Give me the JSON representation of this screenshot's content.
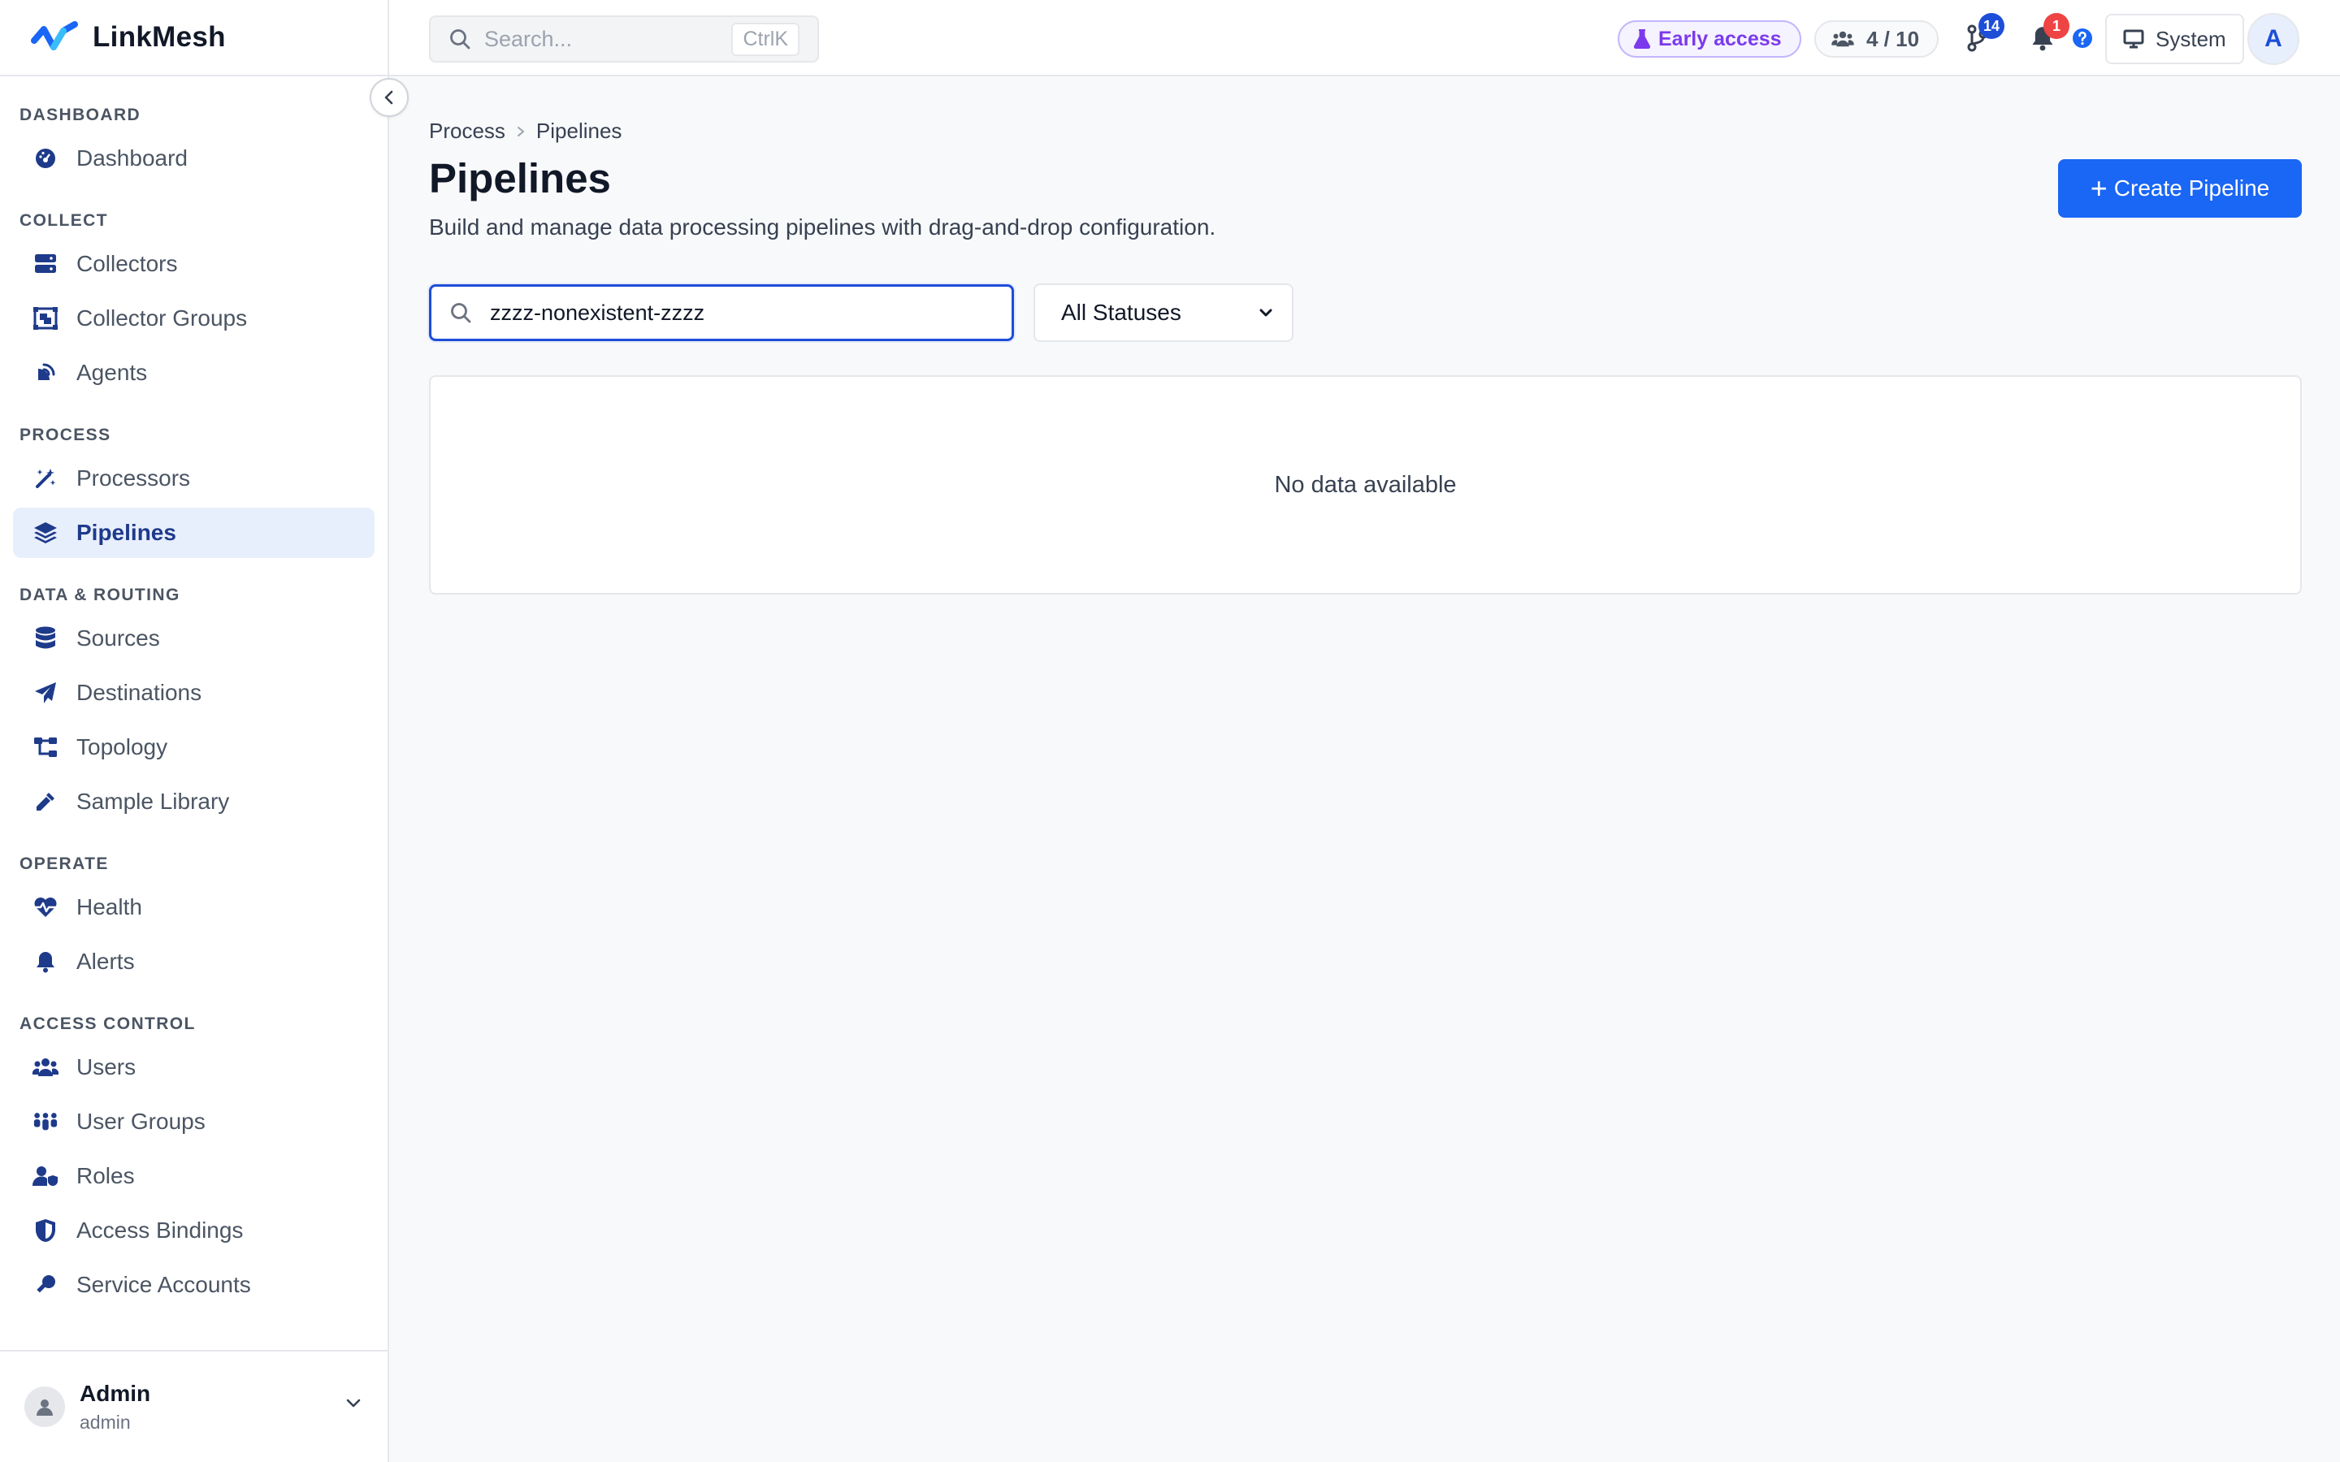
{
  "brand": {
    "name": "LinkMesh"
  },
  "topbar": {
    "search_placeholder": "Search...",
    "search_shortcut": "CtrlK",
    "early_access_label": "Early access",
    "seats_used": "4 / 10",
    "git_badge_count": "14",
    "notifications_count": "1",
    "theme_label": "System",
    "avatar_initial": "A"
  },
  "sidebar": {
    "sections": [
      {
        "title": "DASHBOARD",
        "items": [
          {
            "label": "Dashboard",
            "icon": "dashboard-icon"
          }
        ]
      },
      {
        "title": "COLLECT",
        "items": [
          {
            "label": "Collectors",
            "icon": "server-icon"
          },
          {
            "label": "Collector Groups",
            "icon": "object-group-icon"
          },
          {
            "label": "Agents",
            "icon": "satellite-dish-icon"
          }
        ]
      },
      {
        "title": "PROCESS",
        "items": [
          {
            "label": "Processors",
            "icon": "magic-wand-icon"
          },
          {
            "label": "Pipelines",
            "icon": "layers-icon",
            "active": true
          }
        ]
      },
      {
        "title": "DATA & ROUTING",
        "items": [
          {
            "label": "Sources",
            "icon": "database-icon"
          },
          {
            "label": "Destinations",
            "icon": "paper-plane-icon"
          },
          {
            "label": "Topology",
            "icon": "sitemap-icon"
          },
          {
            "label": "Sample Library",
            "icon": "eyedropper-icon"
          }
        ]
      },
      {
        "title": "OPERATE",
        "items": [
          {
            "label": "Health",
            "icon": "heart-pulse-icon"
          },
          {
            "label": "Alerts",
            "icon": "bell-icon"
          }
        ]
      },
      {
        "title": "ACCESS CONTROL",
        "items": [
          {
            "label": "Users",
            "icon": "users-icon"
          },
          {
            "label": "User Groups",
            "icon": "people-group-icon"
          },
          {
            "label": "Roles",
            "icon": "user-shield-icon"
          },
          {
            "label": "Access Bindings",
            "icon": "shield-icon"
          },
          {
            "label": "Service Accounts",
            "icon": "key-icon"
          }
        ]
      }
    ]
  },
  "user": {
    "name": "Admin",
    "role": "admin"
  },
  "breadcrumb": {
    "parent": "Process",
    "current": "Pipelines"
  },
  "page": {
    "title": "Pipelines",
    "description": "Build and manage data processing pipelines with drag-and-drop configuration.",
    "create_label": "Create Pipeline"
  },
  "filters": {
    "search_value": "zzzz-nonexistent-zzzz",
    "status_selected": "All Statuses"
  },
  "empty_state": {
    "message": "No data available"
  },
  "colors": {
    "primary": "#1a66f5",
    "nav_icon": "#1e3a8a",
    "active_bg": "#e8effc",
    "early_access": "#7c3aed",
    "notification_badge": "#ef4444",
    "git_badge": "#1d4ed8"
  }
}
